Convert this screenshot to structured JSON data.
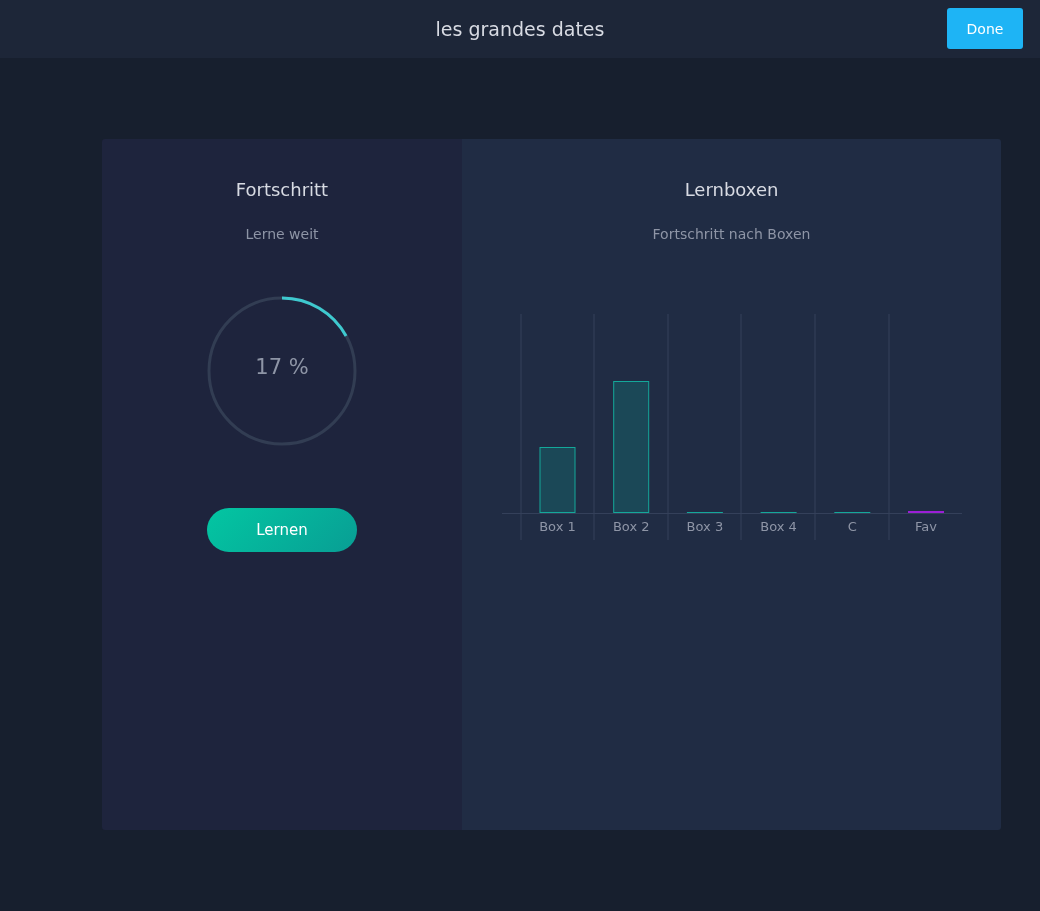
{
  "header": {
    "title": "les grandes dates",
    "done_button": "Done"
  },
  "progress_panel": {
    "title": "Fortschritt",
    "subtitle": "Lerne weit",
    "progress": {
      "level": 0.17,
      "reading": "17 %"
    },
    "learn_button": "Lernen"
  },
  "boxes_panel": {
    "title": "Lernboxen",
    "subtitle": "Fortschritt nach Boxen",
    "categories": [
      {
        "label": "Box 1",
        "color": "#1b4857"
      },
      {
        "label": "Box 2",
        "color": "#1b4857"
      },
      {
        "label": "Box 3",
        "color": "#14a89a"
      },
      {
        "label": "Box 4",
        "color": "#14a89a"
      },
      {
        "label": "C",
        "color": "#14a89a"
      },
      {
        "label": "Fav",
        "color": "#9b1fd6"
      }
    ]
  }
}
